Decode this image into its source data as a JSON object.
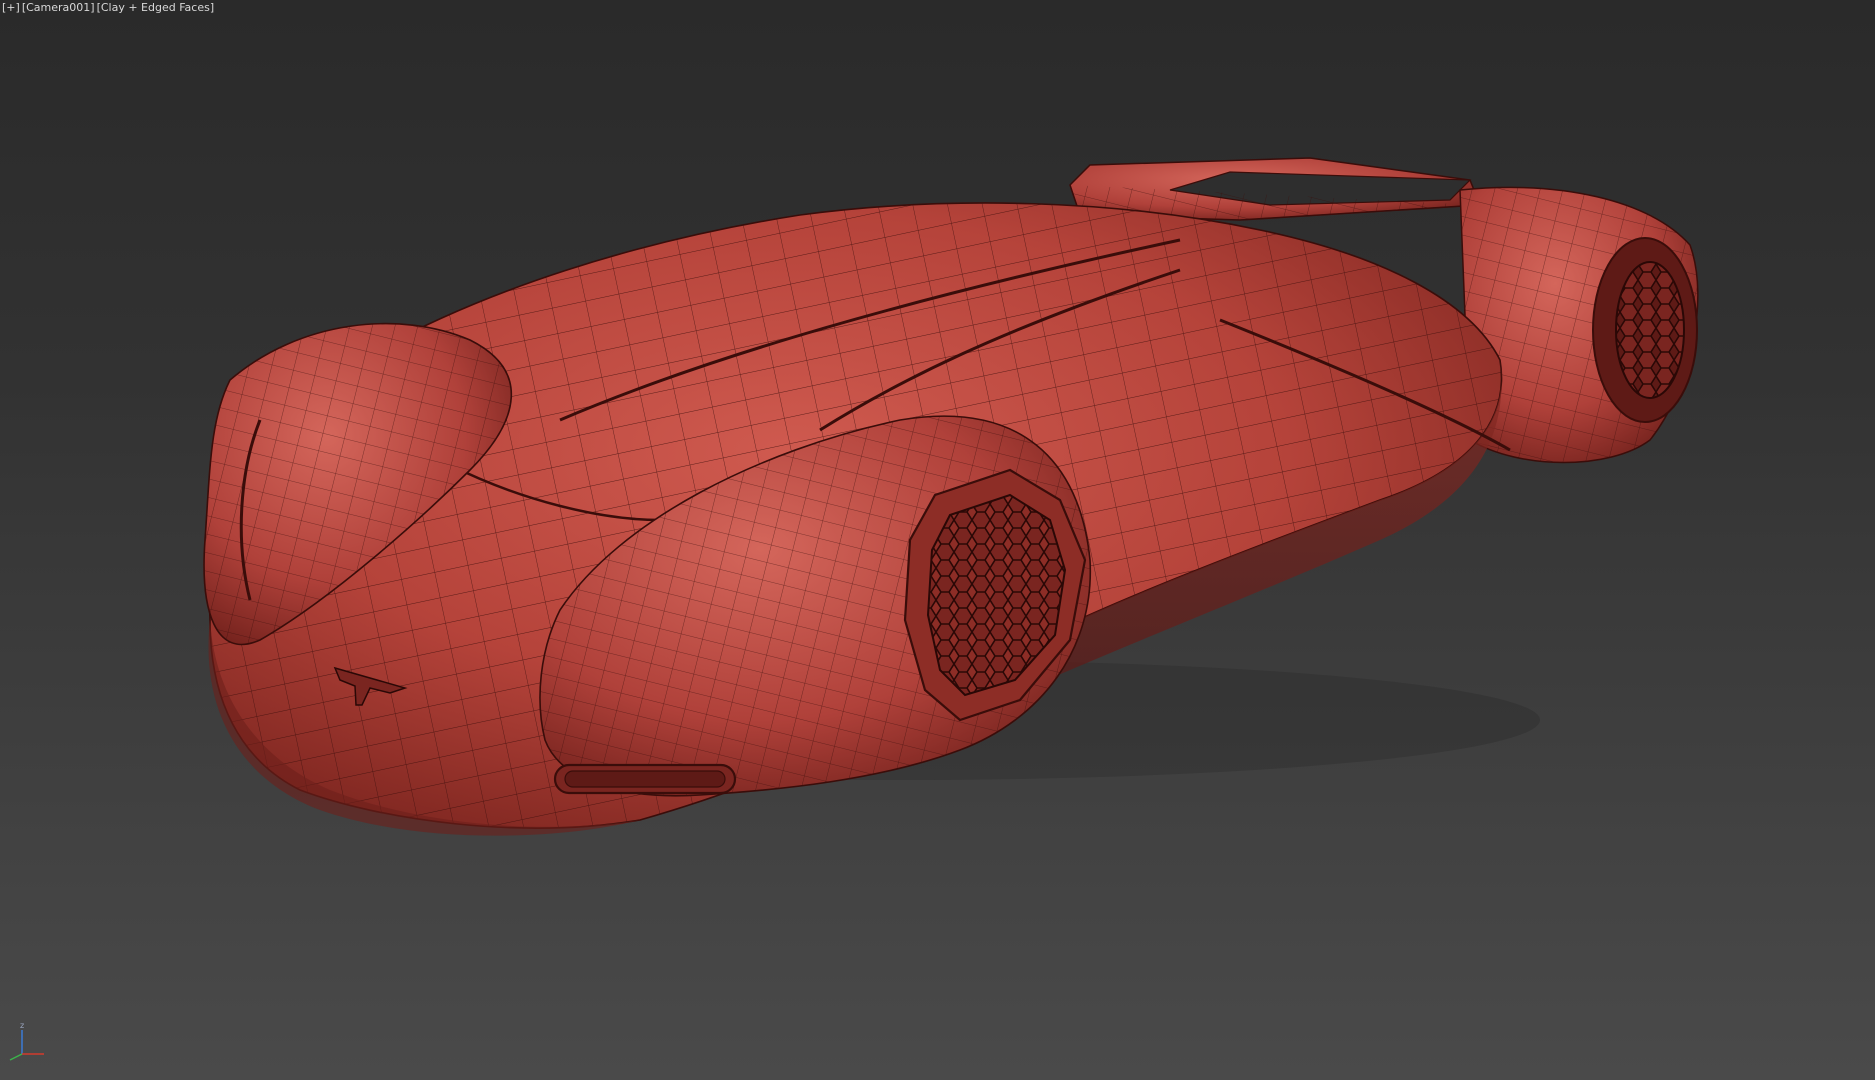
{
  "viewport": {
    "menu_plus": "[+]",
    "camera_label": "[Camera001]",
    "shading_label": "[Clay + Edged Faces]"
  },
  "axis_gizmo": {
    "z_label": "z"
  },
  "colors": {
    "background_top": "#2a2a2a",
    "background_bottom": "#4a4a4a",
    "clay_body": "#b5433a",
    "clay_highlight": "#d4665b",
    "clay_shadow": "#6e1f1a",
    "wire_edges": "#3a0d0a",
    "gizmo_x": "#d33b2c",
    "gizmo_y": "#3bb34a",
    "gizmo_z": "#3a7bd5"
  },
  "icons": {
    "gizmo": "axis-tripod-icon"
  }
}
